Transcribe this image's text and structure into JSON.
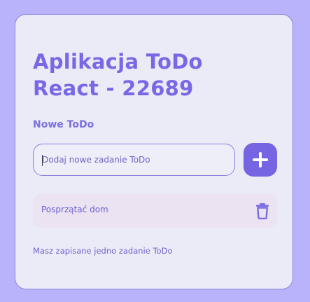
{
  "app": {
    "title": "Aplikacja ToDo React - 22689"
  },
  "new_todo": {
    "label": "Nowe ToDo",
    "placeholder": "Dodaj nowe zadanie ToDo",
    "value": "",
    "add_icon": "plus-icon"
  },
  "tasks": [
    {
      "text": "Posprzątać dom",
      "delete_icon": "trash-icon"
    }
  ],
  "summary": "Masz zapisane jedno zadanie ToDo",
  "colors": {
    "background": "#b9b3fb",
    "card": "#ebebf7",
    "accent": "#7565e3",
    "task_bg": "#ebe3f2"
  }
}
